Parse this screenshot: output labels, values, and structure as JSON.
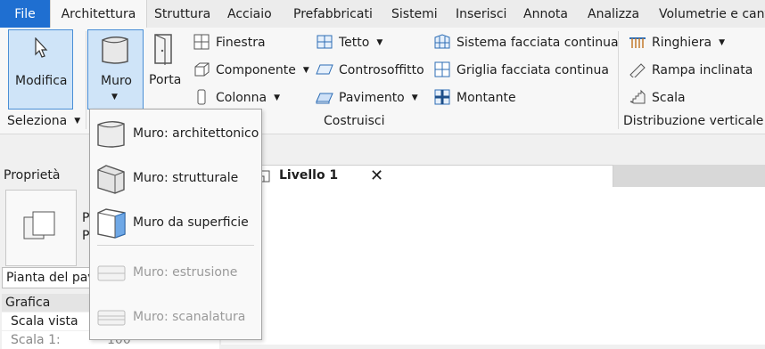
{
  "tabs": {
    "file": "File",
    "architettura": "Architettura",
    "struttura": "Struttura",
    "acciaio": "Acciaio",
    "prefabbricati": "Prefabbricati",
    "sistemi": "Sistemi",
    "inserisci": "Inserisci",
    "annota": "Annota",
    "analizza": "Analizza",
    "volumetrie": "Volumetrie e cant"
  },
  "ribbon": {
    "modifica": "Modifica",
    "muro": "Muro",
    "porta": "Porta",
    "finestra": "Finestra",
    "componente": "Componente",
    "colonna": "Colonna",
    "tetto": "Tetto",
    "controsoffitto": "Controsoffitto",
    "pavimento": "Pavimento",
    "sistema_facciata": "Sistema facciata continua",
    "griglia_facciata": "Griglia facciata continua",
    "montante": "Montante",
    "ringhiera": "Ringhiera",
    "rampa": "Rampa inclinata",
    "scala": "Scala",
    "panel_seleziona": "Seleziona",
    "panel_costruisci": "Costruisci",
    "panel_distribuzione": "Distribuzione verticale"
  },
  "properties": {
    "title": "Proprietà",
    "type_selector": "Pianta del pav",
    "section": "Grafica",
    "row1": "Scala vista",
    "row2": "Scala 1:",
    "row2_value": "100",
    "thumb_text_a": "P",
    "thumb_text_b": "P"
  },
  "view": {
    "tab_label": "Livello 1",
    "close": "✕"
  },
  "dropdown": {
    "items": [
      {
        "label": "Muro: architettonico",
        "enabled": true
      },
      {
        "label": "Muro: strutturale",
        "enabled": true
      },
      {
        "label": "Muro da superficie",
        "enabled": true
      },
      {
        "label": "Muro: estrusione",
        "enabled": false
      },
      {
        "label": "Muro: scanalatura",
        "enabled": false
      }
    ]
  },
  "colors": {
    "file_tab": "#1f6fd1",
    "selected_button": "#cfe4f8",
    "selected_border": "#4a8fd6",
    "disabled_text": "#9a9a9a"
  }
}
